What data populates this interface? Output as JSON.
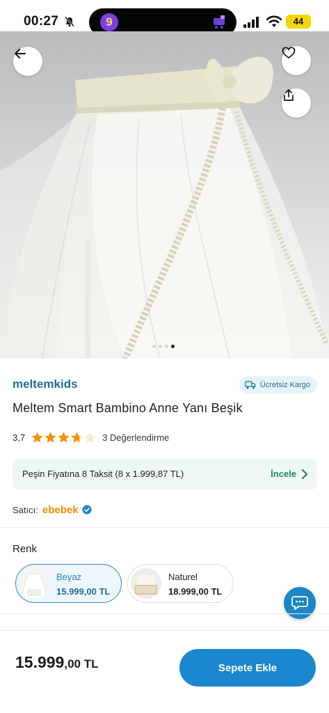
{
  "status_bar": {
    "time": "00:27",
    "battery": "44",
    "island_logo": "9",
    "icons": [
      "bell-muted-icon",
      "cart-icon",
      "signal-icon",
      "wifi-icon",
      "battery-icon"
    ]
  },
  "product_image": {
    "icons": [
      "back-arrow-icon",
      "heart-icon",
      "share-icon"
    ],
    "dots_total": 4,
    "dots_active_index": 3
  },
  "product": {
    "brand": "meltemkids",
    "shipping_badge": "Ücretsiz Kargo",
    "title": "Meltem Smart Bambino Anne Yanı Beşik",
    "rating_value": "3,7",
    "rating_stars": 3.7,
    "review_count": "3 Değerlendirme"
  },
  "installment": {
    "text": "Peşin Fiyatına 8 Taksit (8 x 1.999,87 TL)",
    "link": "İncele"
  },
  "seller": {
    "label": "Satıcı:",
    "name": "ebebek"
  },
  "color_section": {
    "label": "Renk",
    "variants": [
      {
        "name": "Beyaz",
        "price": "15.999,00 TL",
        "selected": true
      },
      {
        "name": "Naturel",
        "price": "18.999,00 TL",
        "selected": false
      }
    ]
  },
  "bottom_bar": {
    "price_int": "15.999",
    "price_rest": ",00 TL",
    "add_to_cart": "Sepete Ekle"
  },
  "colors": {
    "brand_blue": "#1e6f95",
    "primary_button": "#1a87cf",
    "star": "#f39200",
    "seller_orange": "#f28c00",
    "installment_green": "#1b8a5a"
  }
}
